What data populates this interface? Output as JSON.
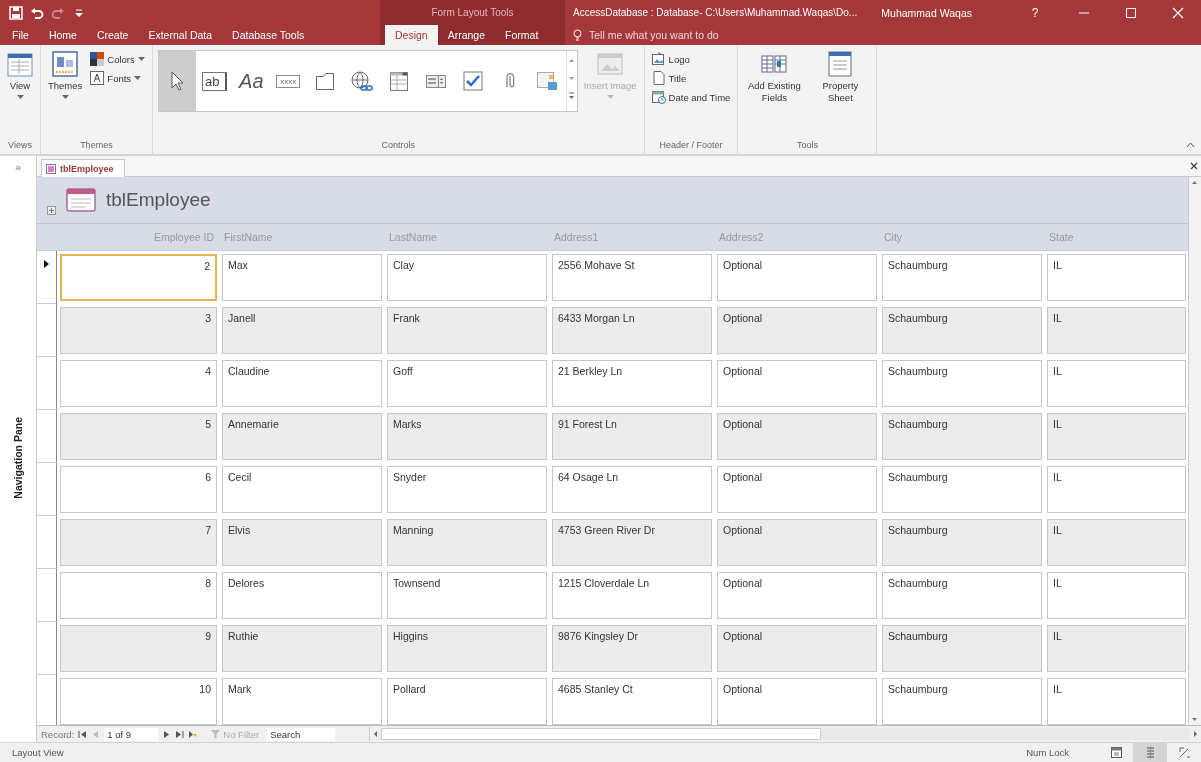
{
  "window": {
    "title": "AccessDatabase : Database- C:\\Users\\Muhammad.Waqas\\Do...",
    "context_title": "Form Layout Tools",
    "user": "Muhammad Waqas",
    "help": "?"
  },
  "quick_access": [
    {
      "kind": "save",
      "disabled": false
    },
    {
      "kind": "undo",
      "disabled": false
    },
    {
      "kind": "redo",
      "disabled": true
    },
    {
      "kind": "customize",
      "disabled": false
    }
  ],
  "ribbon_tabs": [
    {
      "label": "File",
      "selected": false,
      "contextual": false
    },
    {
      "label": "Home",
      "selected": false,
      "contextual": false
    },
    {
      "label": "Create",
      "selected": false,
      "contextual": false
    },
    {
      "label": "External Data",
      "selected": false,
      "contextual": false
    },
    {
      "label": "Database Tools",
      "selected": false,
      "contextual": false
    },
    {
      "label": "Design",
      "selected": true,
      "contextual": true
    },
    {
      "label": "Arrange",
      "selected": false,
      "contextual": true
    },
    {
      "label": "Format",
      "selected": false,
      "contextual": true
    }
  ],
  "tell_me": {
    "placeholder": "Tell me what you want to do"
  },
  "ribbon": {
    "groups": [
      {
        "label": "Views",
        "items": [
          {
            "kind": "view",
            "label": "View",
            "dropdown": true,
            "disabled": false
          }
        ]
      },
      {
        "label": "Themes",
        "items": [
          {
            "kind": "themes",
            "label": "Themes",
            "dropdown": true,
            "disabled": false
          },
          {
            "kind": "colors",
            "label": "Colors",
            "dropdown": true,
            "disabled": false
          },
          {
            "kind": "fonts",
            "label": "Fonts",
            "dropdown": true,
            "disabled": false
          }
        ]
      },
      {
        "label": "Controls",
        "items": [
          {
            "kind": "gallery",
            "controls": [
              {
                "kind": "pointer",
                "selected": true
              },
              {
                "kind": "textbox",
                "glyph": "ab",
                "selected": false
              },
              {
                "kind": "label",
                "glyph": "Aa",
                "selected": false
              },
              {
                "kind": "button",
                "glyph": "xxxx",
                "selected": false
              },
              {
                "kind": "tab",
                "selected": false
              },
              {
                "kind": "hyperlink",
                "selected": false
              },
              {
                "kind": "browser",
                "selected": false
              },
              {
                "kind": "navigation",
                "selected": false
              },
              {
                "kind": "checkbox",
                "selected": false
              },
              {
                "kind": "attachment",
                "selected": false
              },
              {
                "kind": "chart",
                "selected": false
              }
            ]
          },
          {
            "kind": "image",
            "label": "Insert Image",
            "dropdown": true,
            "disabled": true
          }
        ]
      },
      {
        "label": "Header / Footer",
        "items": [
          {
            "kind": "logo",
            "label": "Logo",
            "dropdown": false,
            "disabled": false
          },
          {
            "kind": "title",
            "label": "Title",
            "dropdown": false,
            "disabled": false
          },
          {
            "kind": "datetime",
            "label": "Date and Time",
            "dropdown": false,
            "disabled": false
          }
        ]
      },
      {
        "label": "Tools",
        "items": [
          {
            "kind": "addfields",
            "label": "Add Existing Fields",
            "dropdown": false,
            "disabled": false
          },
          {
            "kind": "propsheet",
            "label": "Property Sheet",
            "dropdown": false,
            "disabled": false
          }
        ]
      }
    ]
  },
  "navigation_pane": {
    "label": "Navigation Pane",
    "toggle": "»"
  },
  "document_tabs": [
    {
      "label": "tblEmployee",
      "selected": true
    }
  ],
  "form": {
    "title": "tblEmployee",
    "columns": [
      "Employee ID",
      "FirstName",
      "LastName",
      "Address1",
      "Address2",
      "City",
      "State"
    ],
    "rows": [
      {
        "cells": [
          "2",
          "Max",
          "Clay",
          "2556 Mohave St",
          "Optional",
          "Schaumburg",
          "IL"
        ],
        "selected": true
      },
      {
        "cells": [
          "3",
          "Janell",
          "Frank",
          "6433 Morgan Ln",
          "Optional",
          "Schaumburg",
          "IL"
        ],
        "selected": false
      },
      {
        "cells": [
          "4",
          "Claudine",
          "Goff",
          "21 Berkley Ln",
          "Optional",
          "Schaumburg",
          "IL"
        ],
        "selected": false
      },
      {
        "cells": [
          "5",
          "Annemarie",
          "Marks",
          "91 Forest Ln",
          "Optional",
          "Schaumburg",
          "IL"
        ],
        "selected": false
      },
      {
        "cells": [
          "6",
          "Cecil",
          "Snyder",
          "64 Osage Ln",
          "Optional",
          "Schaumburg",
          "IL"
        ],
        "selected": false
      },
      {
        "cells": [
          "7",
          "Elvis",
          "Manning",
          "4753 Green River Dr",
          "Optional",
          "Schaumburg",
          "IL"
        ],
        "selected": false
      },
      {
        "cells": [
          "8",
          "Delores",
          "Townsend",
          "1215 Cloverdale Ln",
          "Optional",
          "Schaumburg",
          "IL"
        ],
        "selected": false
      },
      {
        "cells": [
          "9",
          "Ruthie",
          "Higgins",
          "9876 Kingsley Dr",
          "Optional",
          "Schaumburg",
          "IL"
        ],
        "selected": false
      },
      {
        "cells": [
          "10",
          "Mark",
          "Pollard",
          "4685 Stanley Ct",
          "Optional",
          "Schaumburg",
          "IL"
        ],
        "selected": false
      }
    ]
  },
  "record_nav": {
    "label": "Record:",
    "position": "1 of 9",
    "filter": "No Filter",
    "filter_active": false,
    "search_placeholder": "Search"
  },
  "status_bar": {
    "mode": "Layout View",
    "indicators": [
      "Num Lock"
    ],
    "views": [
      {
        "kind": "form",
        "selected": false
      },
      {
        "kind": "layout",
        "selected": true
      },
      {
        "kind": "design",
        "selected": false
      }
    ]
  }
}
